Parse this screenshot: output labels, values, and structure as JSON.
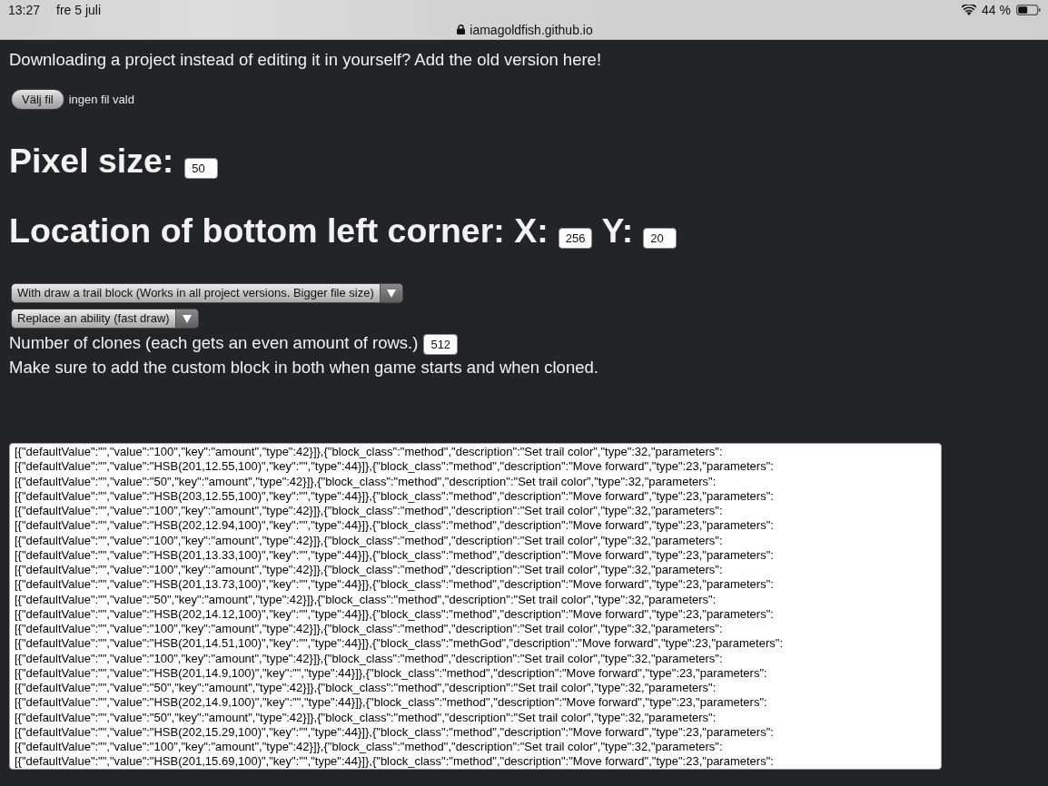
{
  "status_bar": {
    "time": "13:27",
    "date": "fre 5 juli",
    "url": "iamagoldfish.github.io",
    "battery": "44 %"
  },
  "intro": "Downloading a project instead of editing it in yourself? Add the old version here!",
  "file_picker": {
    "button": "Välj fil",
    "status": "ingen fil vald"
  },
  "pixel_size": {
    "label": "Pixel size:",
    "value": "50"
  },
  "location": {
    "label": "Location of bottom left corner: X:",
    "x_value": "256",
    "y_label": "Y:",
    "y_value": "20"
  },
  "selects": [
    {
      "value": "With draw a trail block (Works in all project versions. Bigger file size)"
    },
    {
      "value": "Replace an ability (fast draw)"
    }
  ],
  "clones": {
    "label": "Number of clones (each gets an even amount of rows.)",
    "value": "512"
  },
  "note": "Make sure to add the custom block in both when game starts and when cloned.",
  "output": {
    "lines": [
      "[{\"defaultValue\":\"\",\"value\":\"100\",\"key\":\"amount\",\"type\":42}]},{\"block_class\":\"method\",\"description\":\"Set trail color\",\"type\":32,\"parameters\":",
      "[{\"defaultValue\":\"\",\"value\":\"HSB(201,12.55,100)\",\"key\":\"\",\"type\":44}]},{\"block_class\":\"method\",\"description\":\"Move forward\",\"type\":23,\"parameters\":",
      "[{\"defaultValue\":\"\",\"value\":\"50\",\"key\":\"amount\",\"type\":42}]},{\"block_class\":\"method\",\"description\":\"Set trail color\",\"type\":32,\"parameters\":",
      "[{\"defaultValue\":\"\",\"value\":\"HSB(203,12.55,100)\",\"key\":\"\",\"type\":44}]},{\"block_class\":\"method\",\"description\":\"Move forward\",\"type\":23,\"parameters\":",
      "[{\"defaultValue\":\"\",\"value\":\"100\",\"key\":\"amount\",\"type\":42}]},{\"block_class\":\"method\",\"description\":\"Set trail color\",\"type\":32,\"parameters\":",
      "[{\"defaultValue\":\"\",\"value\":\"HSB(202,12.94,100)\",\"key\":\"\",\"type\":44}]},{\"block_class\":\"method\",\"description\":\"Move forward\",\"type\":23,\"parameters\":",
      "[{\"defaultValue\":\"\",\"value\":\"100\",\"key\":\"amount\",\"type\":42}]},{\"block_class\":\"method\",\"description\":\"Set trail color\",\"type\":32,\"parameters\":",
      "[{\"defaultValue\":\"\",\"value\":\"HSB(201,13.33,100)\",\"key\":\"\",\"type\":44}]},{\"block_class\":\"method\",\"description\":\"Move forward\",\"type\":23,\"parameters\":",
      "[{\"defaultValue\":\"\",\"value\":\"100\",\"key\":\"amount\",\"type\":42}]},{\"block_class\":\"method\",\"description\":\"Set trail color\",\"type\":32,\"parameters\":",
      "[{\"defaultValue\":\"\",\"value\":\"HSB(201,13.73,100)\",\"key\":\"\",\"type\":44}]},{\"block_class\":\"method\",\"description\":\"Move forward\",\"type\":23,\"parameters\":",
      "[{\"defaultValue\":\"\",\"value\":\"50\",\"key\":\"amount\",\"type\":42}]},{\"block_class\":\"method\",\"description\":\"Set trail color\",\"type\":32,\"parameters\":",
      "[{\"defaultValue\":\"\",\"value\":\"HSB(202,14.12,100)\",\"key\":\"\",\"type\":44}]},{\"block_class\":\"method\",\"description\":\"Move forward\",\"type\":23,\"parameters\":",
      "[{\"defaultValue\":\"\",\"value\":\"100\",\"key\":\"amount\",\"type\":42}]},{\"block_class\":\"method\",\"description\":\"Set trail color\",\"type\":32,\"parameters\":",
      "[{\"defaultValue\":\"\",\"value\":\"HSB(201,14.51,100)\",\"key\":\"\",\"type\":44}]},{\"block_class\":\"methGod\",\"description\":\"Move forward\",\"type\":23,\"parameters\":",
      "[{\"defaultValue\":\"\",\"value\":\"100\",\"key\":\"amount\",\"type\":42}]},{\"block_class\":\"method\",\"description\":\"Set trail color\",\"type\":32,\"parameters\":",
      "[{\"defaultValue\":\"\",\"value\":\"HSB(201,14.9,100)\",\"key\":\"\",\"type\":44}]},{\"block_class\":\"method\",\"description\":\"Move forward\",\"type\":23,\"parameters\":",
      "[{\"defaultValue\":\"\",\"value\":\"50\",\"key\":\"amount\",\"type\":42}]},{\"block_class\":\"method\",\"description\":\"Set trail color\",\"type\":32,\"parameters\":",
      "[{\"defaultValue\":\"\",\"value\":\"HSB(202,14.9,100)\",\"key\":\"\",\"type\":44}]},{\"block_class\":\"method\",\"description\":\"Move forward\",\"type\":23,\"parameters\":",
      "[{\"defaultValue\":\"\",\"value\":\"50\",\"key\":\"amount\",\"type\":42}]},{\"block_class\":\"method\",\"description\":\"Set trail color\",\"type\":32,\"parameters\":",
      "[{\"defaultValue\":\"\",\"value\":\"HSB(202,15.29,100)\",\"key\":\"\",\"type\":44}]},{\"block_class\":\"method\",\"description\":\"Move forward\",\"type\":23,\"parameters\":",
      "[{\"defaultValue\":\"\",\"value\":\"100\",\"key\":\"amount\",\"type\":42}]},{\"block_class\":\"method\",\"description\":\"Set trail color\",\"type\":32,\"parameters\":",
      "[{\"defaultValue\":\"\",\"value\":\"HSB(201,15.69,100)\",\"key\":\"\",\"type\":44}]},{\"block_class\":\"method\",\"description\":\"Move forward\",\"type\":23,\"parameters\":"
    ]
  }
}
